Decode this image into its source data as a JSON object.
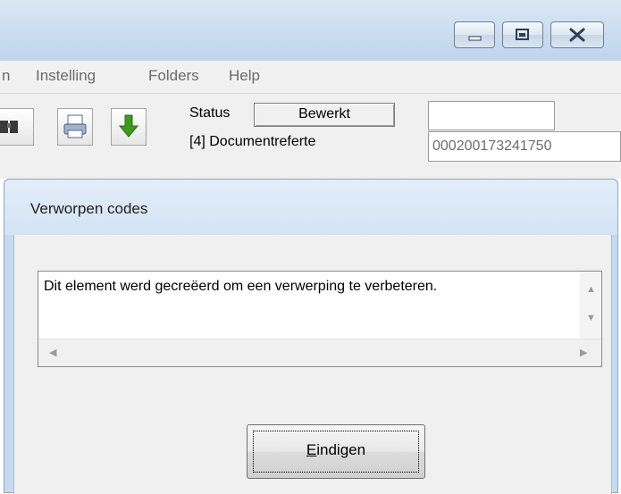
{
  "window": {
    "controls": {
      "minimize": "minimize-icon",
      "maximize": "maximize-icon",
      "close": "close-icon"
    }
  },
  "menu": {
    "items": [
      {
        "label": "n"
      },
      {
        "label": "Instelling"
      },
      {
        "label": "Folders"
      },
      {
        "label": "Help"
      }
    ]
  },
  "toolbar": {
    "buttons": [
      {
        "icon": "binoculars-icon"
      },
      {
        "icon": "printer-icon"
      },
      {
        "icon": "green-down-arrow-icon"
      }
    ],
    "status_label": "Status",
    "status_value": "Bewerkt",
    "docref_label": "[4] Documentreferte",
    "top_field_value": "",
    "docref_value": "000200173241750"
  },
  "dialog": {
    "title": "Verworpen codes",
    "message": "Dit element werd gecreëerd om een verwerping te verbeteren.",
    "close_button_label": "Eindigen",
    "close_button_mnemonic": "E",
    "close_button_rest": "indigen"
  },
  "colors": {
    "accent_green": "#3c9a1e",
    "titlebar": "#c9dcf0"
  }
}
